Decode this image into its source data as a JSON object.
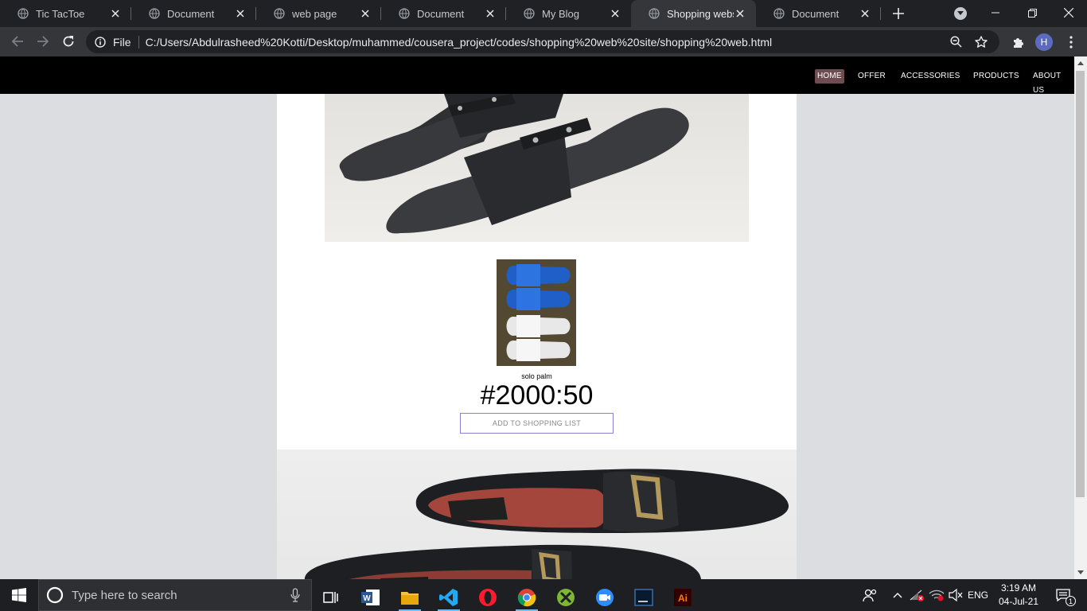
{
  "browser": {
    "tabs": [
      {
        "title": "Tic TacToe",
        "active": false
      },
      {
        "title": "Document",
        "active": false
      },
      {
        "title": "web page",
        "active": false
      },
      {
        "title": "Document",
        "active": false
      },
      {
        "title": "My Blog",
        "active": false
      },
      {
        "title": "Shopping website",
        "active": true
      },
      {
        "title": "Document",
        "active": false
      }
    ],
    "file_label": "File",
    "url": "C:/Users/Abdulrasheed%20Kotti/Desktop/muhammed/cousera_project/codes/shopping%20web%20site/shopping%20web.html",
    "profile_initial": "H"
  },
  "site": {
    "nav": {
      "home": "HOME",
      "offer": "OFFER",
      "accessories": "ACCESSORIES",
      "products": "PRODUCTS",
      "about": "ABOUT US"
    },
    "product": {
      "name": "solo palm",
      "price": "#2000:50",
      "add_button": "ADD TO SHOPPING LIST"
    }
  },
  "taskbar": {
    "search_placeholder": "Type here to search",
    "language": "ENG",
    "time": "3:19 AM",
    "date": "04-Jul-21",
    "notification_count": "1"
  }
}
